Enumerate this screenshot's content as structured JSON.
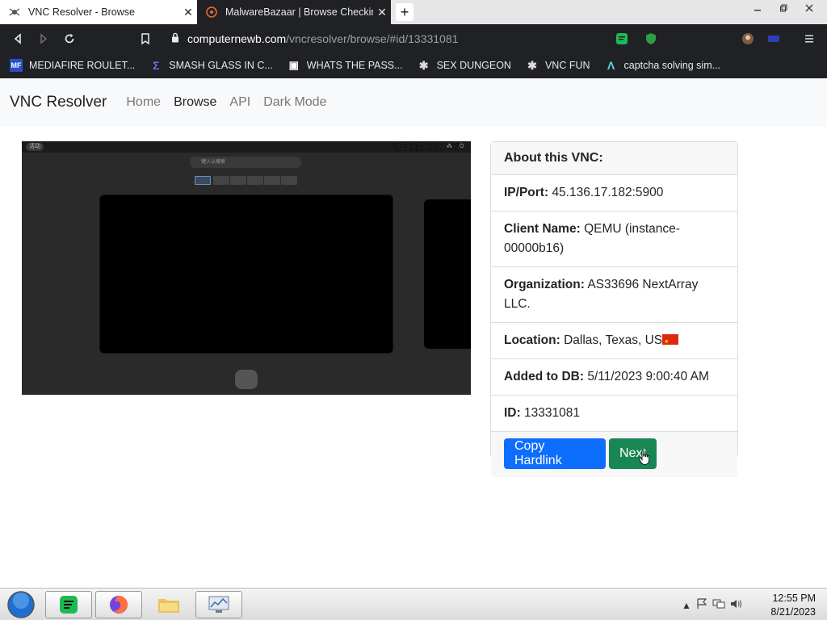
{
  "browser": {
    "tabs": [
      {
        "title": "VNC Resolver - Browse",
        "active": true,
        "close": "✕"
      },
      {
        "title": "MalwareBazaar | Browse Checking",
        "active": false,
        "close": "✕"
      }
    ],
    "new_tab": "+",
    "url_host": "computernewb.com",
    "url_path": "/vncresolver/browse/#id/13331081",
    "bookmarks": [
      {
        "label": "MEDIAFIRE ROULET...",
        "icon": "mf-icon",
        "glyph": "MF"
      },
      {
        "label": "SMASH GLASS IN C...",
        "icon": "sigma-icon",
        "glyph": "Σ"
      },
      {
        "label": "WHATS THE PASS...",
        "icon": "monitor-icon",
        "glyph": "▣"
      },
      {
        "label": "SEX DUNGEON",
        "icon": "spider-icon",
        "glyph": "✱"
      },
      {
        "label": "VNC FUN",
        "icon": "spider-icon",
        "glyph": "✱"
      },
      {
        "label": "captcha solving sim...",
        "icon": "lambda-icon",
        "glyph": "Λ"
      }
    ]
  },
  "site": {
    "brand": "VNC Resolver",
    "nav": [
      {
        "label": "Home",
        "current": false
      },
      {
        "label": "Browse",
        "current": true
      },
      {
        "label": "API",
        "current": false
      },
      {
        "label": "Dark Mode",
        "current": false
      }
    ]
  },
  "screenshot": {
    "activities": "活动",
    "clock": "5月1日 23：32",
    "search_placeholder": "键入以搜索"
  },
  "card": {
    "header": "About this VNC:",
    "ip_label": "IP/Port:",
    "ip_value": "45.136.17.182:5900",
    "client_label": "Client Name:",
    "client_value": "QEMU (instance-00000b16)",
    "org_label": "Organization:",
    "org_value": "AS33696 NextArray LLC.",
    "location_label": "Location:",
    "location_value": "Dallas, Texas, US",
    "added_label": "Added to DB:",
    "added_value": "5/11/2023 9:00:40 AM",
    "id_label": "ID:",
    "id_value": "13331081",
    "copy_button": "Copy Hardlink",
    "next_button": "Next"
  },
  "taskbar": {
    "time": "12:55 PM",
    "date": "8/21/2023"
  }
}
